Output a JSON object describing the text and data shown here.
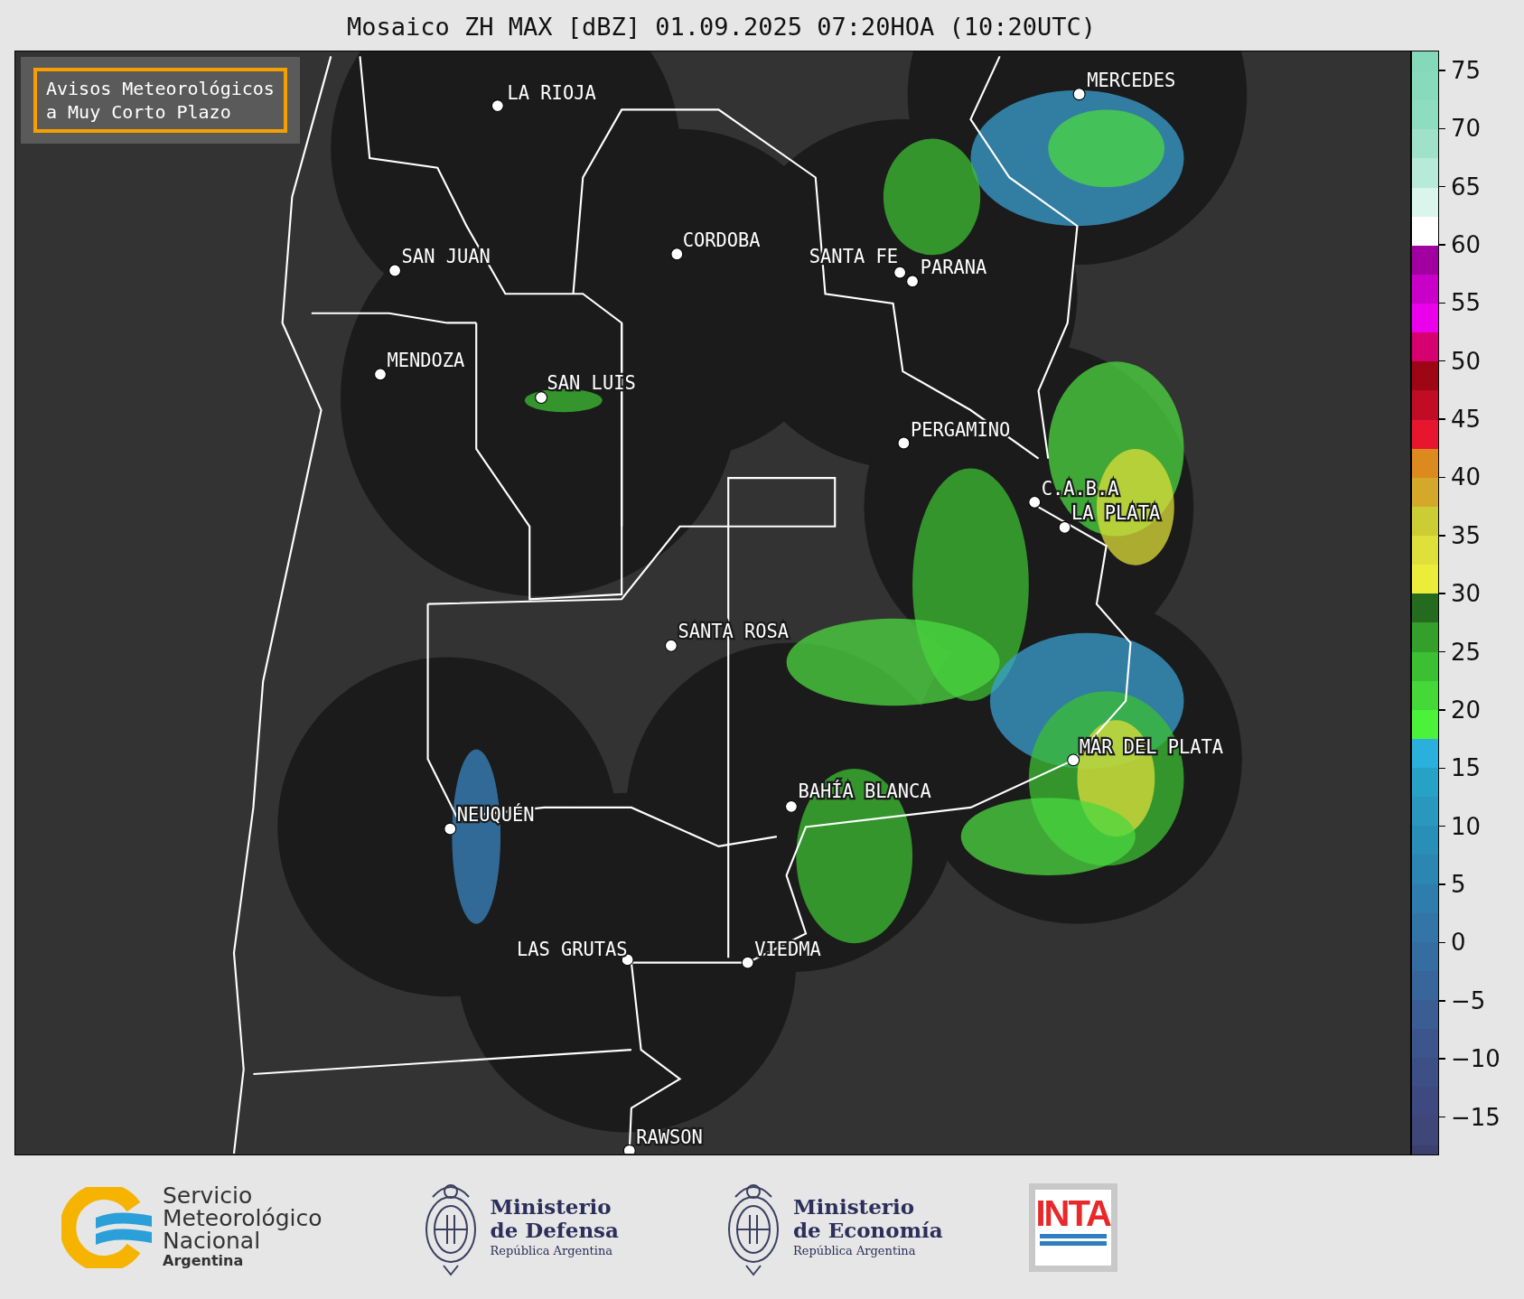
{
  "title": "Mosaico ZH MAX [dBZ] 01.09.2025 07:20HOA (10:20UTC)",
  "notice": {
    "lines": [
      "Avisos Meteorológicos",
      "a Muy Corto Plazo"
    ]
  },
  "cities": [
    {
      "name": "LA RIOJA"
    },
    {
      "name": "MERCEDES"
    },
    {
      "name": "CORDOBA"
    },
    {
      "name": "SAN JUAN"
    },
    {
      "name": "SANTA FE"
    },
    {
      "name": "PARANA"
    },
    {
      "name": "MENDOZA"
    },
    {
      "name": "SAN LUIS"
    },
    {
      "name": "PERGAMINO"
    },
    {
      "name": "C.A.B.A"
    },
    {
      "name": "LA PLATA"
    },
    {
      "name": "SANTA ROSA"
    },
    {
      "name": "MAR DEL PLATA"
    },
    {
      "name": "BAHÍA BLANCA"
    },
    {
      "name": "NEUQUÉN"
    },
    {
      "name": "LAS GRUTAS"
    },
    {
      "name": "VIEDMA"
    },
    {
      "name": "RAWSON"
    }
  ],
  "colorbar": {
    "ticks": [
      "75",
      "70",
      "65",
      "60",
      "55",
      "50",
      "45",
      "40",
      "35",
      "30",
      "25",
      "20",
      "15",
      "10",
      "5",
      "0",
      "−5",
      "−10",
      "−15"
    ],
    "segments": [
      {
        "color": "#3d3f6e"
      },
      {
        "color": "#3f4678"
      },
      {
        "color": "#3e4a7f"
      },
      {
        "color": "#3d5086"
      },
      {
        "color": "#3c568d"
      },
      {
        "color": "#3a5d93"
      },
      {
        "color": "#38659a"
      },
      {
        "color": "#356da0"
      },
      {
        "color": "#3275a6"
      },
      {
        "color": "#2f7dac"
      },
      {
        "color": "#2c86b2"
      },
      {
        "color": "#2a8fb8"
      },
      {
        "color": "#2898be"
      },
      {
        "color": "#26a2c6"
      },
      {
        "color": "#2ab0dc"
      },
      {
        "color": "#4af23a"
      },
      {
        "color": "#44d838"
      },
      {
        "color": "#3cbf33"
      },
      {
        "color": "#34a02b"
      },
      {
        "color": "#246b20"
      },
      {
        "color": "#ecec3a"
      },
      {
        "color": "#e0e03a"
      },
      {
        "color": "#cccc35"
      },
      {
        "color": "#d4a828"
      },
      {
        "color": "#dc8a1e"
      },
      {
        "color": "#e8152f"
      },
      {
        "color": "#c00c24"
      },
      {
        "color": "#9e0515"
      },
      {
        "color": "#d6006e"
      },
      {
        "color": "#ea00ea"
      },
      {
        "color": "#c800c8"
      },
      {
        "color": "#a000a0"
      },
      {
        "color": "#ffffff"
      },
      {
        "color": "#d9f5ec"
      },
      {
        "color": "#b8ead9"
      },
      {
        "color": "#9fe2c9"
      },
      {
        "color": "#8fddc1"
      },
      {
        "color": "#88dabd"
      },
      {
        "color": "#84d9bb"
      }
    ]
  },
  "footer": {
    "smn": {
      "lines": [
        "Servicio",
        "Meteorológico",
        "Nacional"
      ],
      "country": "Argentina"
    },
    "ministries": [
      {
        "lines": [
          "Ministerio",
          "de Defensa"
        ],
        "country": "República Argentina"
      },
      {
        "lines": [
          "Ministerio",
          "de Economía"
        ],
        "country": "República Argentina"
      }
    ],
    "inta": {
      "label": "INTA"
    }
  }
}
